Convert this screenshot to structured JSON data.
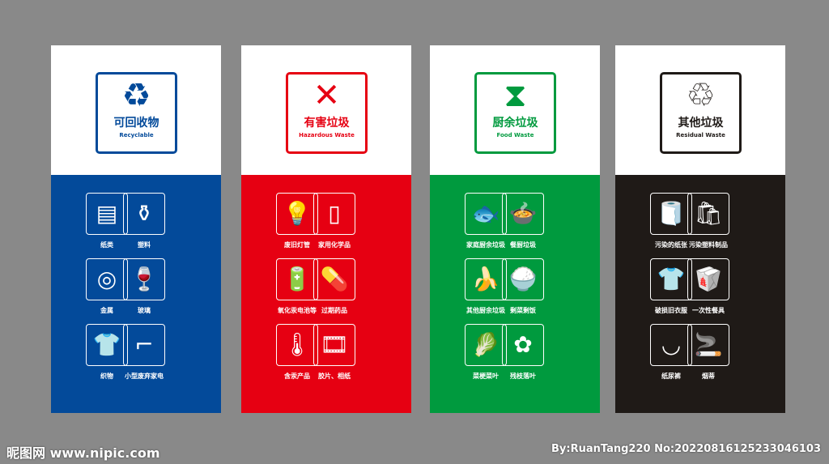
{
  "panels": [
    {
      "title_cn": "可回收物",
      "title_en": "Recyclable",
      "color": "#034a9a",
      "symbol": "♻",
      "items": [
        {
          "label": "纸类",
          "icon": "newspaper-icon",
          "glyph": "▤"
        },
        {
          "label": "塑料",
          "icon": "bottle-icon",
          "glyph": "⚱"
        },
        {
          "label": "金属",
          "icon": "can-icon",
          "glyph": "◎"
        },
        {
          "label": "玻璃",
          "icon": "wine-glass-icon",
          "glyph": "🍷"
        },
        {
          "label": "织物",
          "icon": "shirt-icon",
          "glyph": "👕"
        },
        {
          "label": "小型废弃家电",
          "icon": "hair-dryer-icon",
          "glyph": "⌐"
        }
      ]
    },
    {
      "title_cn": "有害垃圾",
      "title_en": "Hazardous Waste",
      "color": "#e60012",
      "symbol": "✕",
      "items": [
        {
          "label": "废旧灯管",
          "icon": "lamp-tube-icon",
          "glyph": "💡"
        },
        {
          "label": "家用化学品",
          "icon": "spray-can-icon",
          "glyph": "▯"
        },
        {
          "label": "氧化汞电池等",
          "icon": "battery-icon",
          "glyph": "🔋"
        },
        {
          "label": "过期药品",
          "icon": "medicine-bottle-icon",
          "glyph": "💊"
        },
        {
          "label": "含汞产品",
          "icon": "thermometer-icon",
          "glyph": "🌡"
        },
        {
          "label": "胶片、相纸",
          "icon": "film-icon",
          "glyph": "🎞"
        }
      ]
    },
    {
      "title_cn": "厨余垃圾",
      "title_en": "Food Waste",
      "color": "#009a3e",
      "symbol": "⧗",
      "items": [
        {
          "label": "家庭厨余垃圾",
          "icon": "food-scraps-icon",
          "glyph": "🐟"
        },
        {
          "label": "餐厨垃圾",
          "icon": "meal-waste-icon",
          "glyph": "🍲"
        },
        {
          "label": "其他厨余垃圾",
          "icon": "banana-peel-icon",
          "glyph": "🍌"
        },
        {
          "label": "剩菜剩饭",
          "icon": "bowl-icon",
          "glyph": "🍚"
        },
        {
          "label": "菜梗菜叶",
          "icon": "cabbage-icon",
          "glyph": "🥬"
        },
        {
          "label": "残枝落叶",
          "icon": "potted-flower-icon",
          "glyph": "✿"
        }
      ]
    },
    {
      "title_cn": "其他垃圾",
      "title_en": "Residual Waste",
      "color": "#1f1a17",
      "symbol": "♲",
      "items": [
        {
          "label": "污染的纸张",
          "icon": "toilet-paper-icon",
          "glyph": "🧻"
        },
        {
          "label": "污染塑料制品",
          "icon": "plastic-bag-icon",
          "glyph": "🛍"
        },
        {
          "label": "破损旧衣服",
          "icon": "old-shirt-icon",
          "glyph": "👕"
        },
        {
          "label": "一次性餐具",
          "icon": "disposable-tableware-icon",
          "glyph": "🥡"
        },
        {
          "label": "纸尿裤",
          "icon": "diaper-icon",
          "glyph": "◡"
        },
        {
          "label": "烟蒂",
          "icon": "cigarette-icon",
          "glyph": "🚬"
        }
      ]
    }
  ],
  "watermark": {
    "left": "昵图网 www.nipic.com",
    "right": "By:RuanTang220 No:20220816125233046103"
  }
}
